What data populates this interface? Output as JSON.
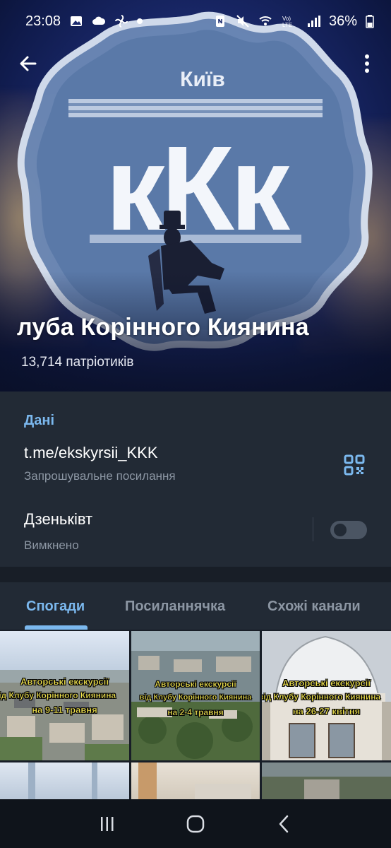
{
  "status_bar": {
    "time": "23:08",
    "battery_percent": "36%",
    "left_icons": [
      "image-icon",
      "cloud-icon",
      "fan-icon",
      "dot-icon"
    ],
    "right_icons": [
      "nfc-icon",
      "mute-icon",
      "wifi-call-icon",
      "volte-icon",
      "signal-icon",
      "battery-icon"
    ]
  },
  "header": {
    "back_icon": "arrow-left-icon",
    "menu_icon": "more-vertical-icon",
    "logo_city": "Київ",
    "logo_letters": "кКк",
    "title": "луба Корінного Киянина",
    "subtitle": "13,714 патріотиків"
  },
  "info": {
    "section_title": "Дані",
    "link": "t.me/ekskyrsii_KKK",
    "link_caption": "Запрошувальне посилання",
    "qr_icon": "qr-code-icon",
    "zen_title": "Дзеньківт",
    "zen_caption": "Вимкнено",
    "zen_enabled": false
  },
  "tabs": [
    {
      "label": "Спогади",
      "active": true
    },
    {
      "label": "Посиланнячка",
      "active": false
    },
    {
      "label": "Схожі канали",
      "active": false
    }
  ],
  "media": [
    {
      "line1": "Авторські екскурсії",
      "line2": "від Клубу Корінного Киянина",
      "line3": "на 9-11 травня"
    },
    {
      "line1": "Авторські екскурсії",
      "line2": "від Клубу Корінного Киянина",
      "line3": "на 2-4 травня"
    },
    {
      "line1": "Авторські екскурсії",
      "line2": "від Клубу Корінного Киянина",
      "line3": "на 26-27 квітня"
    }
  ],
  "navbar": {
    "recent_icon": "recents-icon",
    "home_icon": "home-icon",
    "back_icon": "back-chevron-icon"
  },
  "colors": {
    "accent": "#7bb8ee",
    "card": "#222a35",
    "background": "#181e27",
    "secondary_text": "#8c96a3",
    "overlay_text": "#f5e74a"
  }
}
